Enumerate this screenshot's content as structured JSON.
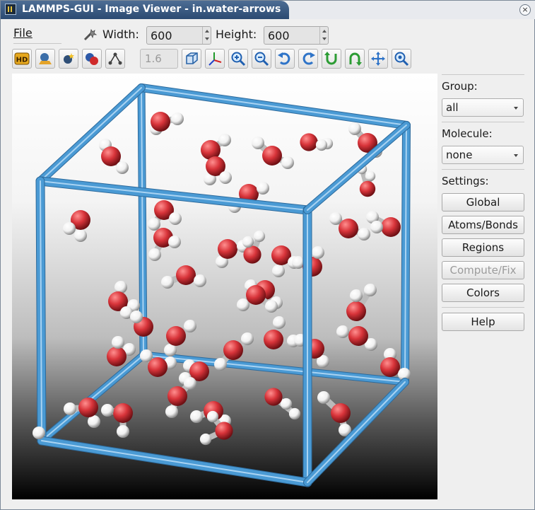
{
  "window": {
    "title": "LAMMPS-GUI - Image Viewer - in.water-arrows",
    "close_glyph": "×"
  },
  "menu": {
    "file": "File"
  },
  "size": {
    "width_label": "Width:",
    "width_value": "600",
    "height_label": "Height:",
    "height_value": "600"
  },
  "toolbar": {
    "buttons": [
      {
        "icon": "hd-icon"
      },
      {
        "icon": "shiny-spheres-icon"
      },
      {
        "icon": "special-icon"
      },
      {
        "icon": "vdw-spheres-icon"
      },
      {
        "icon": "bonds-icon"
      },
      {
        "icon": "box-icon"
      },
      {
        "icon": "axes-icon"
      },
      {
        "icon": "zoom-in-icon"
      },
      {
        "icon": "zoom-out-icon"
      },
      {
        "icon": "rotate-left-icon"
      },
      {
        "icon": "rotate-right-icon"
      },
      {
        "icon": "rotate-up-icon"
      },
      {
        "icon": "rotate-down-icon"
      },
      {
        "icon": "recenter-icon"
      },
      {
        "icon": "reset-view-icon"
      }
    ],
    "bond_field": "1.6"
  },
  "sidebar": {
    "group_label": "Group:",
    "group_value": "all",
    "molecule_label": "Molecule:",
    "molecule_value": "none",
    "settings_label": "Settings:",
    "buttons": {
      "global": "Global",
      "atoms_bonds": "Atoms/Bonds",
      "regions": "Regions",
      "compute_fix": "Compute/Fix",
      "colors": "Colors",
      "help": "Help"
    }
  },
  "colors": {
    "title_bar": "#2b4a72",
    "box_edge": "#4a9ad4",
    "oxygen": "#d8343a",
    "hydrogen": "#f0f0f0"
  }
}
